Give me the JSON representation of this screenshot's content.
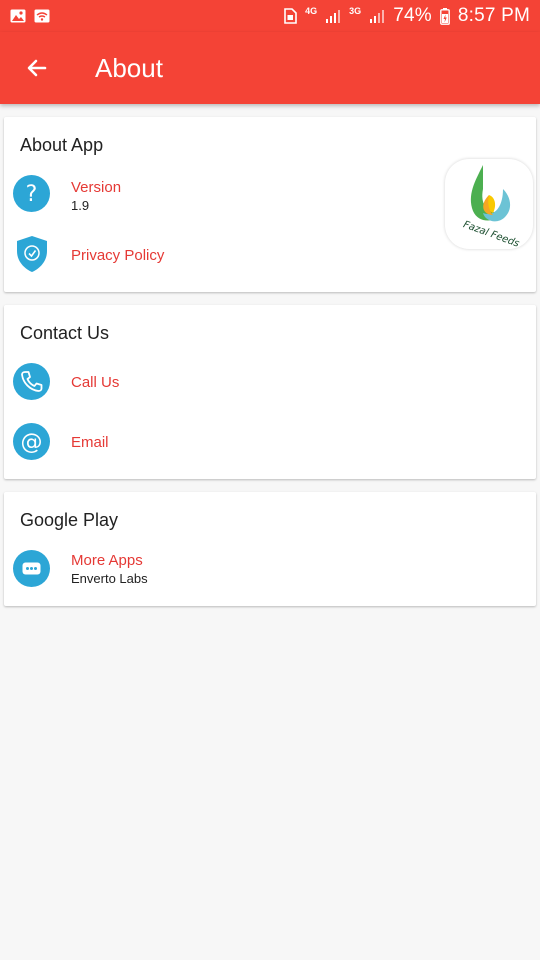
{
  "status_bar": {
    "net1": "4G",
    "net2": "3G",
    "battery": "74%",
    "time": "8:57 PM"
  },
  "app_bar": {
    "title": "About"
  },
  "about_app": {
    "title": "About App",
    "version_label": "Version",
    "version_value": "1.9",
    "privacy_label": "Privacy Policy",
    "logo_text": "Fazal Feeds"
  },
  "contact": {
    "title": "Contact Us",
    "call_label": "Call Us",
    "email_label": "Email"
  },
  "google_play": {
    "title": "Google Play",
    "more_apps_label": "More Apps",
    "developer": "Enverto Labs"
  },
  "colors": {
    "accent": "#f44336",
    "icon_blue": "#2ca6d6",
    "label_red": "#e53935"
  }
}
